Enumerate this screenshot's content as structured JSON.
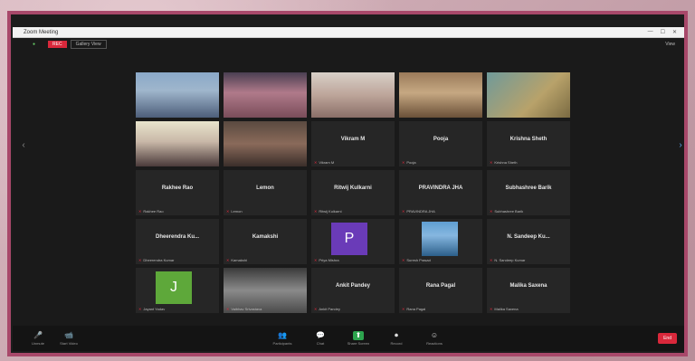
{
  "window": {
    "title": "Zoom Meeting",
    "controls": [
      "—",
      "☐",
      "✕"
    ]
  },
  "top_strip": {
    "recording": "REC",
    "gallery": "Gallery View",
    "view": "View"
  },
  "participants": [
    {
      "name_tag": "",
      "kind": "video",
      "video_class": "v1"
    },
    {
      "name_tag": "",
      "kind": "video",
      "video_class": "v2"
    },
    {
      "name_tag": "",
      "kind": "video",
      "video_class": "v3"
    },
    {
      "name_tag": "",
      "kind": "video",
      "video_class": "v4"
    },
    {
      "name_tag": "",
      "kind": "video",
      "video_class": "v5"
    },
    {
      "name_tag": "",
      "kind": "video",
      "video_class": "v6"
    },
    {
      "name_tag": "",
      "kind": "video",
      "video_class": "v7"
    },
    {
      "display": "Vikram M",
      "name_tag": "Vikram M",
      "kind": "name"
    },
    {
      "display": "Pooja",
      "name_tag": "Pooja",
      "kind": "name"
    },
    {
      "display": "Krishna Sheth",
      "name_tag": "Krishna Sheth",
      "kind": "name"
    },
    {
      "display": "Rakhee Rao",
      "name_tag": "Rakhee Rao",
      "kind": "name"
    },
    {
      "display": "Lemon",
      "name_tag": "Lemon",
      "kind": "name"
    },
    {
      "display": "Ritwij Kulkarni",
      "name_tag": "Ritwij Kulkarni",
      "kind": "name"
    },
    {
      "display": "PRAVINDRA JHA",
      "name_tag": "PRAVINDRA JHA",
      "kind": "name"
    },
    {
      "display": "Subhashree Barik",
      "name_tag": "Subhashree Barik",
      "kind": "name"
    },
    {
      "display": "Dheerendra Ku...",
      "name_tag": "Dheerendra Kumar",
      "kind": "name"
    },
    {
      "display": "Kamakshi",
      "name_tag": "Kamakshi",
      "kind": "name"
    },
    {
      "letter": "P",
      "name_tag": "Priya Mishra",
      "kind": "avatar",
      "color": "#6a3bb8"
    },
    {
      "name_tag": "Suresh Prasad",
      "kind": "photo"
    },
    {
      "display": "N. Sandeep Ku...",
      "name_tag": "N. Sandeep Kumar",
      "kind": "name"
    },
    {
      "letter": "J",
      "name_tag": "Jayant Yadav",
      "kind": "avatar",
      "color": "#5ea83a"
    },
    {
      "name_tag": "Vaibhav Srivastava",
      "kind": "video",
      "video_class": "v8"
    },
    {
      "display": "Ankit Pandey",
      "name_tag": "Ankit Pandey",
      "kind": "name"
    },
    {
      "display": "Rana Pagal",
      "name_tag": "Rana Pagal",
      "kind": "name"
    },
    {
      "display": "Malika Saxena",
      "name_tag": "Malika Saxena",
      "kind": "name"
    }
  ],
  "toolbar": {
    "left": [
      {
        "icon": "🎤",
        "label": "Unmute"
      },
      {
        "icon": "📹",
        "label": "Start Video"
      }
    ],
    "center": [
      {
        "icon": "👥",
        "label": "Participants"
      },
      {
        "icon": "💬",
        "label": "Chat"
      },
      {
        "icon": "⬆",
        "label": "Share Screen",
        "share": true
      },
      {
        "icon": "⏺",
        "label": "Record"
      },
      {
        "icon": "☺",
        "label": "Reactions"
      }
    ],
    "end": "End"
  },
  "colors": {
    "frame": "#a8486a",
    "record": "#d9283b",
    "share": "#2da44e"
  }
}
